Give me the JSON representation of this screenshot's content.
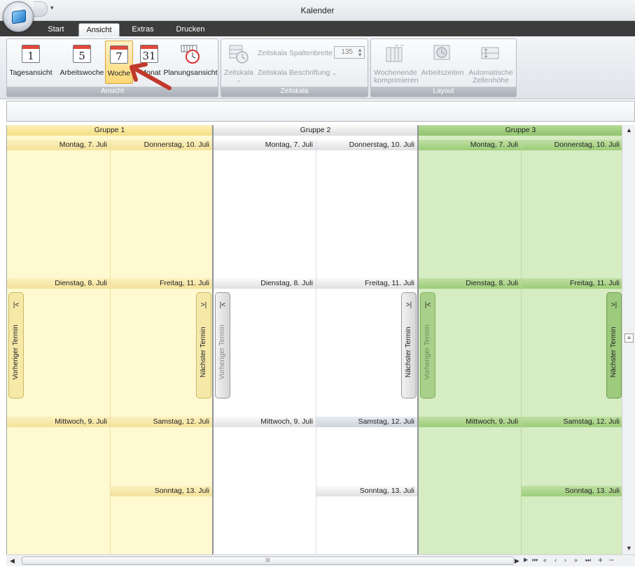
{
  "window": {
    "title": "Kalender"
  },
  "tabs": [
    {
      "label": "Start",
      "active": false
    },
    {
      "label": "Ansicht",
      "active": true
    },
    {
      "label": "Extras",
      "active": false
    },
    {
      "label": "Drucken",
      "active": false
    }
  ],
  "ribbon": {
    "ansicht": {
      "caption": "Ansicht",
      "buttons": [
        {
          "label": "Tagesansicht",
          "icon_number": "1",
          "icon": "calendar-day-icon"
        },
        {
          "label": "Arbeitswoche",
          "icon_number": "5",
          "icon": "calendar-workweek-icon"
        },
        {
          "label": "Woche",
          "icon_number": "7",
          "icon": "calendar-week-icon",
          "selected": true
        },
        {
          "label": "Monat",
          "icon_number": "31",
          "icon": "calendar-month-icon"
        },
        {
          "label": "Planungsansicht",
          "icon": "timeline-clock-icon"
        }
      ]
    },
    "zeitskala": {
      "caption": "Zeitskala",
      "zeitskala_label": "Zeitskala",
      "spaltenbreite_label": "Zeitskala Spaltenbreite",
      "spaltenbreite_value": "135",
      "beschriftung_label": "Zeitskala Beschriftung"
    },
    "layout": {
      "caption": "Layout",
      "wochenende_label_1": "Wochenende",
      "wochenende_label_2": "komprimieren",
      "arbeitszeiten_label": "Arbeitszeiten",
      "zellenhoehe_label_1": "Automatische",
      "zellenhoehe_label_2": "Zellenhöhe"
    }
  },
  "colors": {
    "group1": "#fef9d0",
    "group2": "#ffffff",
    "group3": "#d6ecc2",
    "annotation_arrow": "#c0392b"
  },
  "calendar": {
    "groups": [
      {
        "name": "Gruppe 1",
        "days": {
          "mon": "Montag, 7. Juli",
          "thu": "Donnerstag, 10. Juli",
          "tue": "Dienstag, 8. Juli",
          "fri": "Freitag, 11. Juli",
          "wed": "Mittwoch, 9. Juli",
          "sat": "Samstag, 12. Juli",
          "sun": "Sonntag, 13. Juli"
        },
        "prev": "Vorheriger Termin",
        "next": "Nächster Termin"
      },
      {
        "name": "Gruppe 2",
        "days": {
          "mon": "Montag, 7. Juli",
          "thu": "Donnerstag, 10. Juli",
          "tue": "Dienstag, 8. Juli",
          "fri": "Freitag, 11. Juli",
          "wed": "Mittwoch, 9. Juli",
          "sat": "Samstag, 12. Juli",
          "sun": "Sonntag, 13. Juli"
        },
        "prev": "Vorheriger Termin",
        "next": "Nächster Termin"
      },
      {
        "name": "Gruppe 3",
        "days": {
          "mon": "Montag, 7. Juli",
          "thu": "Donnerstag, 10. Juli",
          "tue": "Dienstag, 8. Juli",
          "fri": "Freitag, 11. Juli",
          "wed": "Mittwoch, 9. Juli",
          "sat": "Samstag, 12. Juli",
          "sun": "Sonntag, 13. Juli"
        },
        "prev": "Vorheriger Termin",
        "next": "Nächster Termin"
      }
    ]
  },
  "scroll": {
    "vertical_middle_icon": "list-icon",
    "horizontal_thumb": "III"
  }
}
